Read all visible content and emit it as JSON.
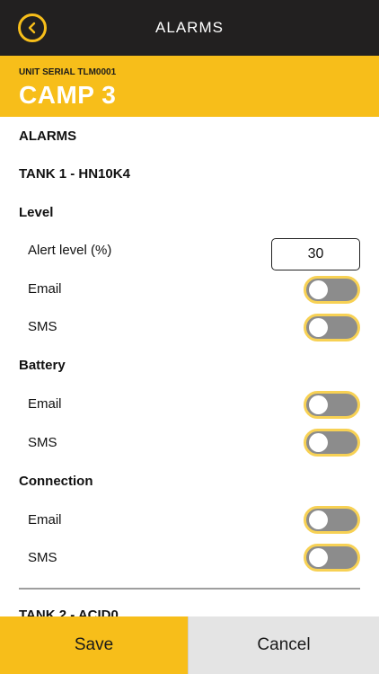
{
  "header": {
    "title": "ALARMS"
  },
  "unit": {
    "serial": "UNIT SERIAL TLM0001",
    "name": "CAMP 3"
  },
  "main": {
    "section_title": "ALARMS",
    "tank1": {
      "title": "TANK 1 - HN10K4",
      "level": {
        "title": "Level",
        "alert_label": "Alert level (%)",
        "alert_value": "30",
        "email_label": "Email",
        "sms_label": "SMS",
        "email_on": false,
        "sms_on": false
      },
      "battery": {
        "title": "Battery",
        "email_label": "Email",
        "sms_label": "SMS",
        "email_on": false,
        "sms_on": false
      },
      "connection": {
        "title": "Connection",
        "email_label": "Email",
        "sms_label": "SMS",
        "email_on": false,
        "sms_on": false
      }
    },
    "tank2": {
      "title": "TANK 2 - ACID0"
    }
  },
  "footer": {
    "save_label": "Save",
    "cancel_label": "Cancel"
  },
  "colors": {
    "accent": "#F7BE1A",
    "topbar": "#222020",
    "toggle_off": "#8c8c8c",
    "toggle_border": "#F7D154"
  },
  "icons": {
    "back": "chevron-left-circle-icon"
  }
}
